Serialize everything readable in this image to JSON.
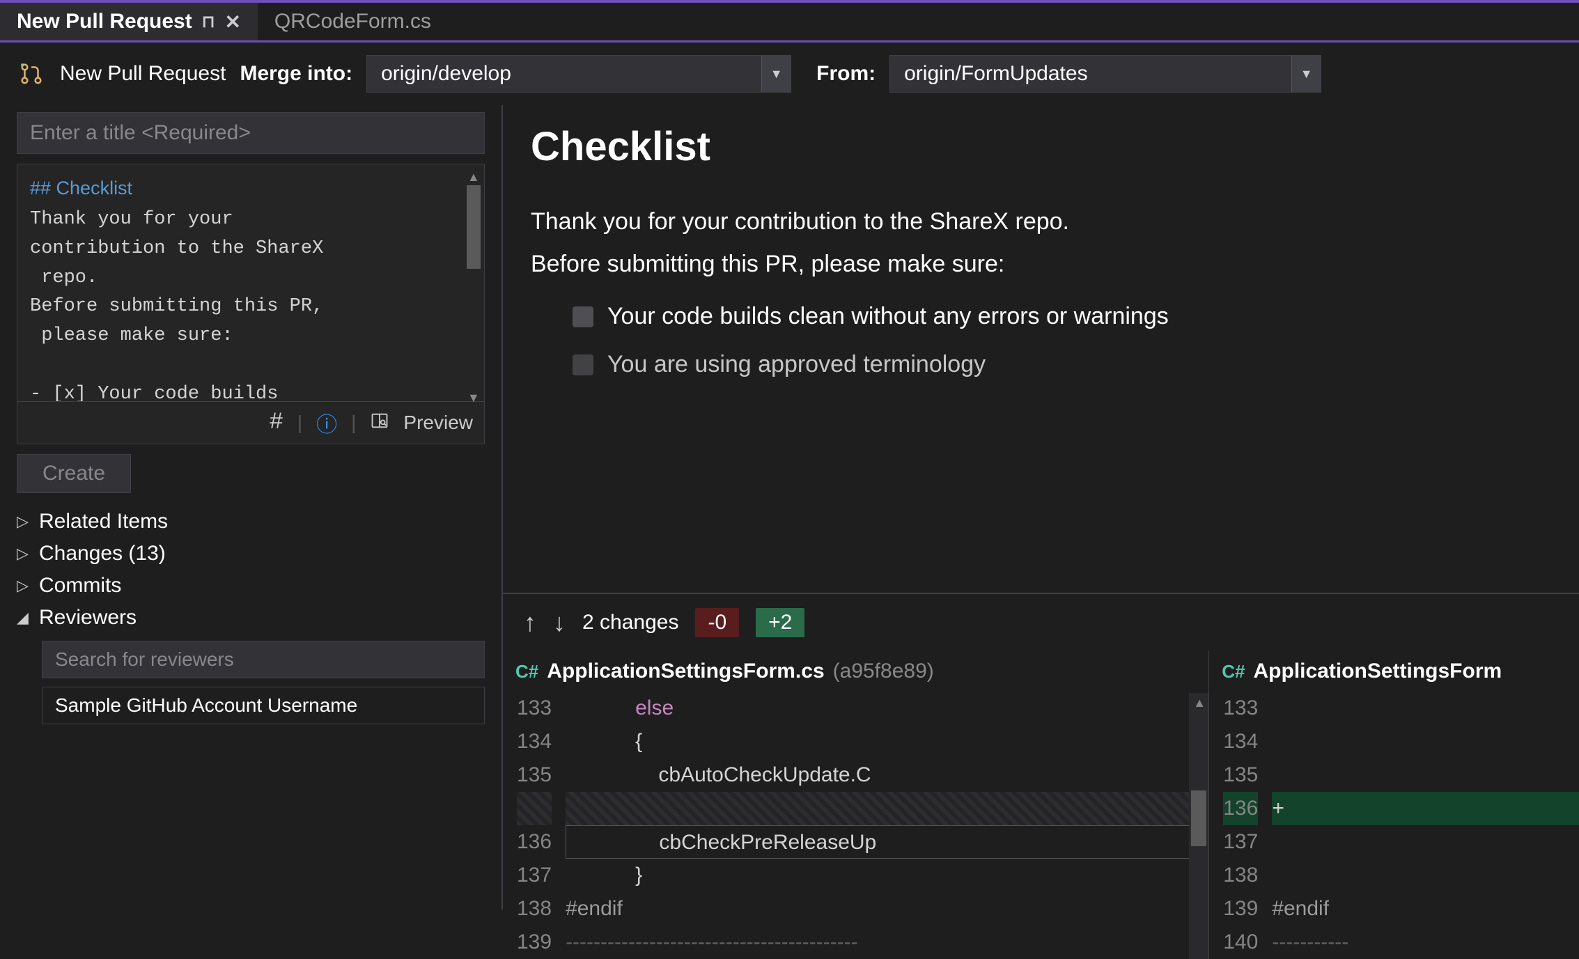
{
  "tabs": {
    "active": "New Pull Request",
    "inactive": "QRCodeForm.cs"
  },
  "toolbar": {
    "title": "New Pull Request",
    "merge_into_label": "Merge into:",
    "merge_into_value": "origin/develop",
    "from_label": "From:",
    "from_value": "origin/FormUpdates"
  },
  "form": {
    "title_placeholder": "Enter a title <Required>",
    "description": "## Checklist\nThank you for your\ncontribution to the ShareX\n repo.\nBefore submitting this PR,\n please make sure:\n\n- [x] Your code builds",
    "preview_label": "Preview",
    "create_label": "Create"
  },
  "tree": {
    "related": "Related Items",
    "changes": "Changes (13)",
    "commits": "Commits",
    "reviewers": "Reviewers",
    "reviewer_search_placeholder": "Search for reviewers",
    "reviewer_sample": "Sample GitHub Account Username"
  },
  "preview": {
    "heading": "Checklist",
    "para1": "Thank you for your contribution to the ShareX repo.",
    "para2": "Before submitting this PR, please make sure:",
    "check1": "Your code builds clean without any errors or warnings",
    "check2": "You are using approved terminology"
  },
  "diff": {
    "changes_text": "2 changes",
    "removed": "-0",
    "added": "+2",
    "left": {
      "lang": "C#",
      "name": "ApplicationSettingsForm.cs",
      "hash": "(a95f8e89)",
      "lines": [
        {
          "n": "133",
          "t": "            else",
          "cls": "kw"
        },
        {
          "n": "134",
          "t": "            {",
          "cls": ""
        },
        {
          "n": "135",
          "t": "                cbAutoCheckUpdate.C",
          "cls": ""
        },
        {
          "n": "",
          "t": "",
          "cls": "gap"
        },
        {
          "n": "136",
          "t": "                cbCheckPreReleaseUp",
          "cls": "sel"
        },
        {
          "n": "137",
          "t": "            }",
          "cls": ""
        },
        {
          "n": "138",
          "t": "#endif",
          "cls": "pp"
        },
        {
          "n": "139",
          "t": "------------------------------------------",
          "cls": "sep"
        }
      ]
    },
    "right": {
      "lang": "C#",
      "name": "ApplicationSettingsForm",
      "lines": [
        {
          "n": "133",
          "t": ""
        },
        {
          "n": "134",
          "t": ""
        },
        {
          "n": "135",
          "t": ""
        },
        {
          "n": "136",
          "t": "+",
          "cls": "add"
        },
        {
          "n": "137",
          "t": ""
        },
        {
          "n": "138",
          "t": ""
        },
        {
          "n": "139",
          "t": "#endif",
          "cls": "pp"
        },
        {
          "n": "140",
          "t": "-----------",
          "cls": "sep"
        }
      ]
    }
  }
}
